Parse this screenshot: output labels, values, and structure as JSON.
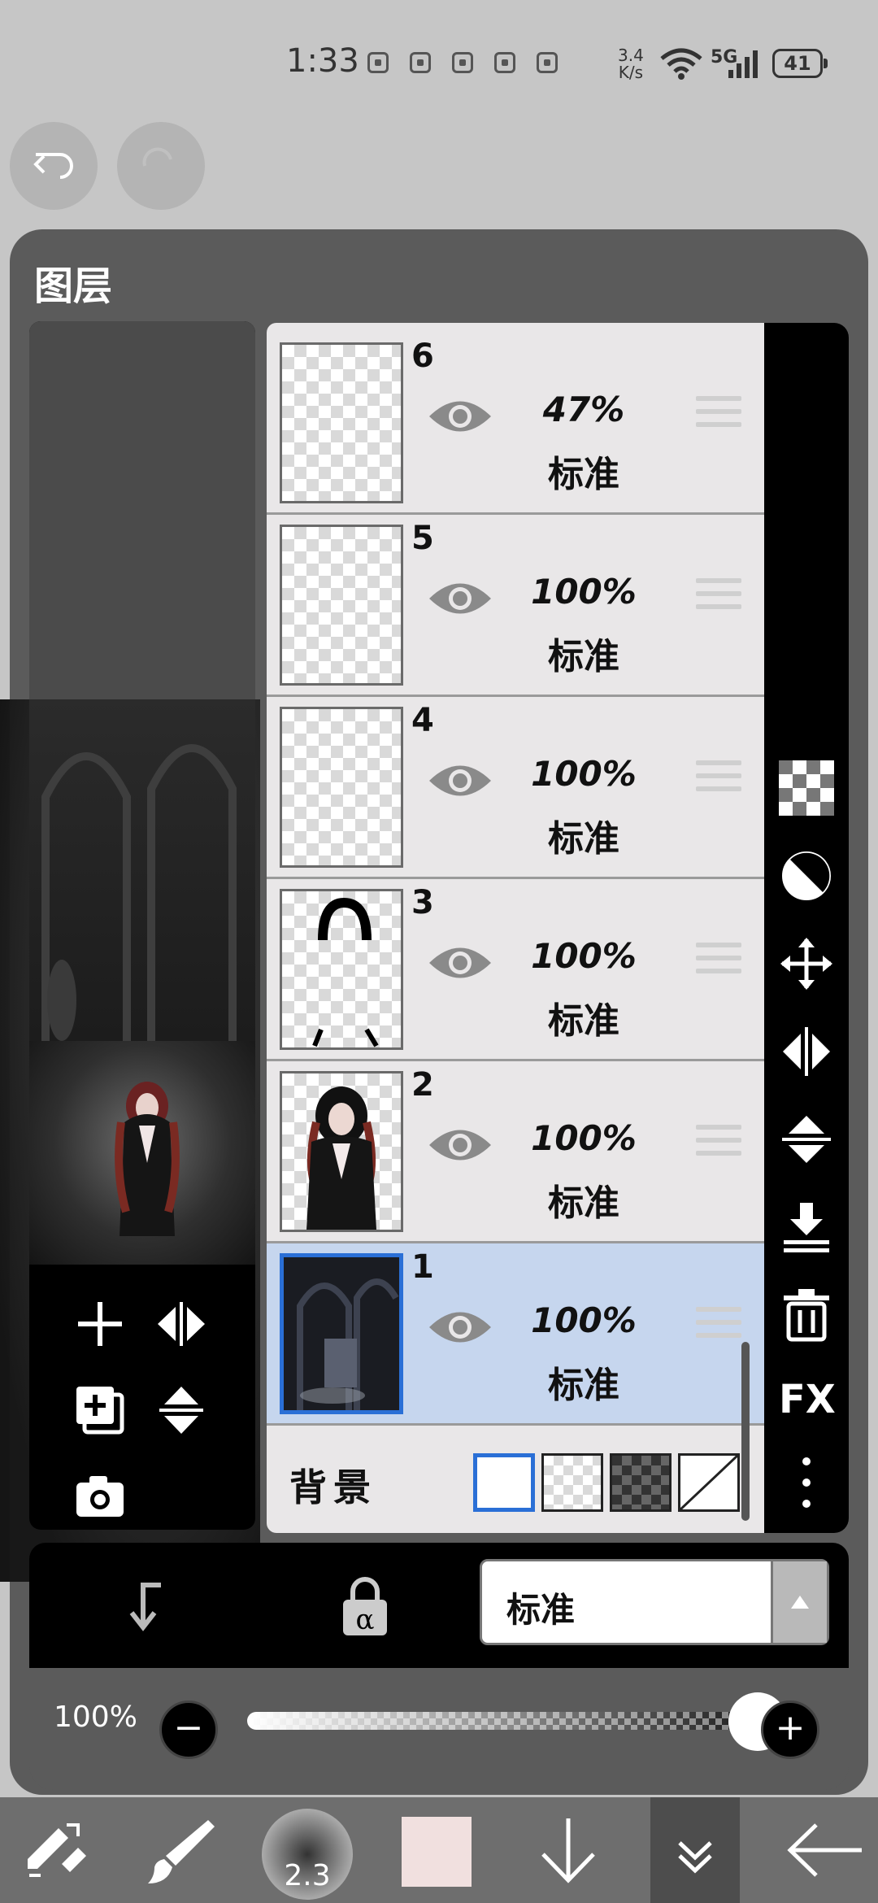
{
  "status": {
    "time": "1:33",
    "net_speed_value": "3.4",
    "net_speed_unit": "K/s",
    "signal_label": "5G",
    "battery": "41"
  },
  "panel": {
    "title": "图层"
  },
  "layers": [
    {
      "number": "6",
      "opacity": "47%",
      "mode": "标准"
    },
    {
      "number": "5",
      "opacity": "100%",
      "mode": "标准"
    },
    {
      "number": "4",
      "opacity": "100%",
      "mode": "标准"
    },
    {
      "number": "3",
      "opacity": "100%",
      "mode": "标准"
    },
    {
      "number": "2",
      "opacity": "100%",
      "mode": "标准"
    },
    {
      "number": "1",
      "opacity": "100%",
      "mode": "标准",
      "selected": true
    }
  ],
  "background": {
    "label": "背景"
  },
  "blend_mode": {
    "selected": "标准"
  },
  "opacity_bar": {
    "label": "100%",
    "value": 1.0
  },
  "right_toolbar": {
    "fx_label": "FX"
  },
  "bottom_toolbar": {
    "brush_size": "2.3",
    "current_color": "#f1e0df"
  },
  "colors": {
    "selected_layer_bg": "#c6d6ee",
    "selected_border": "#2a6fd6"
  }
}
